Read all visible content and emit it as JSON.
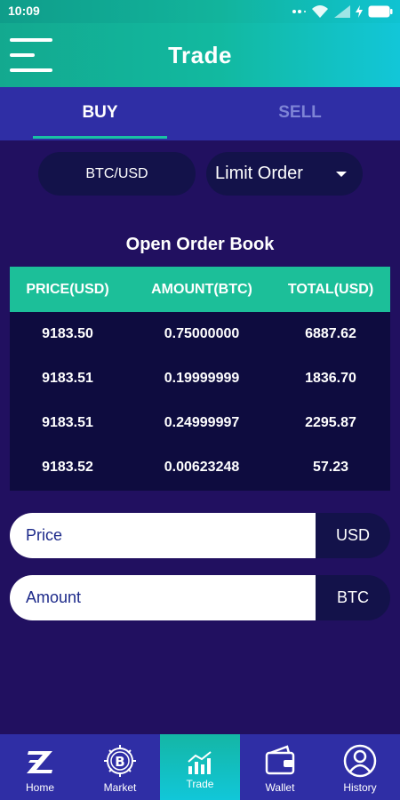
{
  "status_bar": {
    "time": "10:09"
  },
  "header": {
    "title": "Trade",
    "menu_icon": "hamburger-menu-icon"
  },
  "tabs": [
    {
      "label": "BUY",
      "active": true
    },
    {
      "label": "SELL",
      "active": false
    }
  ],
  "selectors": {
    "pair": "BTC/USD",
    "order_type": "Limit Order"
  },
  "order_book": {
    "title": "Open Order Book",
    "columns": [
      "PRICE(USD)",
      "AMOUNT(BTC)",
      "TOTAL(USD)"
    ],
    "rows": [
      [
        "9183.50",
        "0.75000000",
        "6887.62"
      ],
      [
        "9183.51",
        "0.19999999",
        "1836.70"
      ],
      [
        "9183.51",
        "0.24999997",
        "2295.87"
      ],
      [
        "9183.52",
        "0.00623248",
        "57.23"
      ]
    ]
  },
  "form": {
    "price": {
      "placeholder": "Price",
      "unit": "USD"
    },
    "amount": {
      "placeholder": "Amount",
      "unit": "BTC"
    }
  },
  "bottom_nav": [
    {
      "label": "Home",
      "icon": "z-logo-icon",
      "active": false
    },
    {
      "label": "Market",
      "icon": "bitcoin-chip-icon",
      "active": false
    },
    {
      "label": "Trade",
      "icon": "bar-chart-icon",
      "active": true
    },
    {
      "label": "Wallet",
      "icon": "wallet-icon",
      "active": false
    },
    {
      "label": "History",
      "icon": "user-circle-icon",
      "active": false
    }
  ],
  "colors": {
    "background": "#211060",
    "header_gradient_start": "#13a98f",
    "header_gradient_end": "#12c6d8",
    "accent": "#1cbf99",
    "tab_bar": "#2f2ea5",
    "dark_panel": "#0e0c3f"
  }
}
